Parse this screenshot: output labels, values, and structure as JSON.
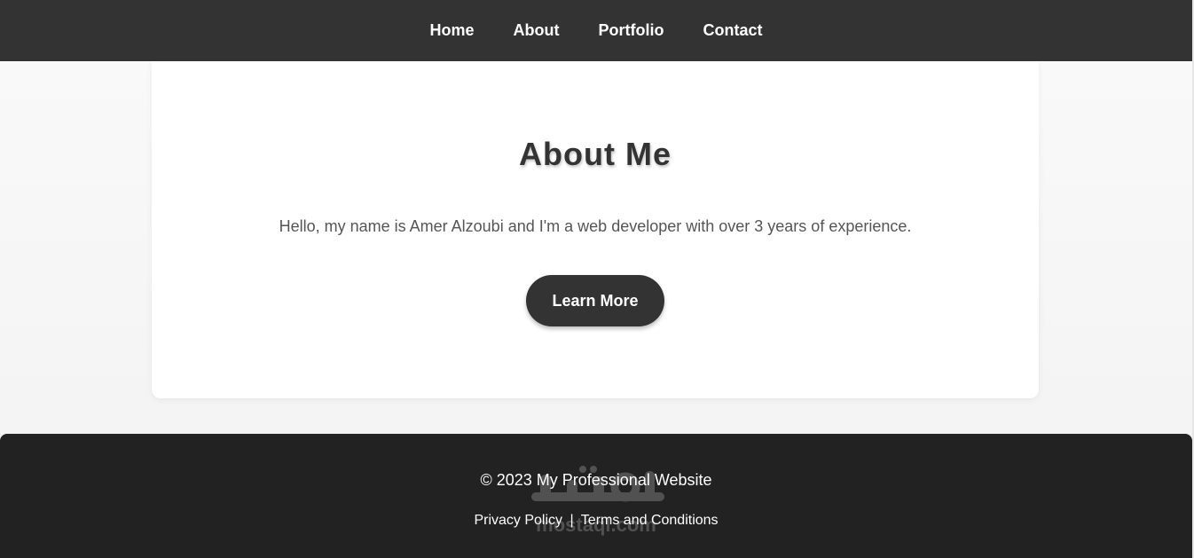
{
  "nav": {
    "items": [
      {
        "label": "Home"
      },
      {
        "label": "About"
      },
      {
        "label": "Portfolio"
      },
      {
        "label": "Contact"
      }
    ]
  },
  "about": {
    "title": "About Me",
    "intro": "Hello, my name is Amer Alzoubi and I'm a web developer with over 3 years of experience.",
    "button_label": "Learn More"
  },
  "footer": {
    "copyright": "© 2023 My Professional Website",
    "privacy_label": "Privacy Policy",
    "separator": "|",
    "terms_label": "Terms and Conditions",
    "watermark_text": "mostaql.com"
  },
  "colors": {
    "header_bg": "#333333",
    "footer_bg": "#222222",
    "button_bg": "#333333",
    "card_bg": "#ffffff",
    "page_bg": "#f5f5f5"
  }
}
